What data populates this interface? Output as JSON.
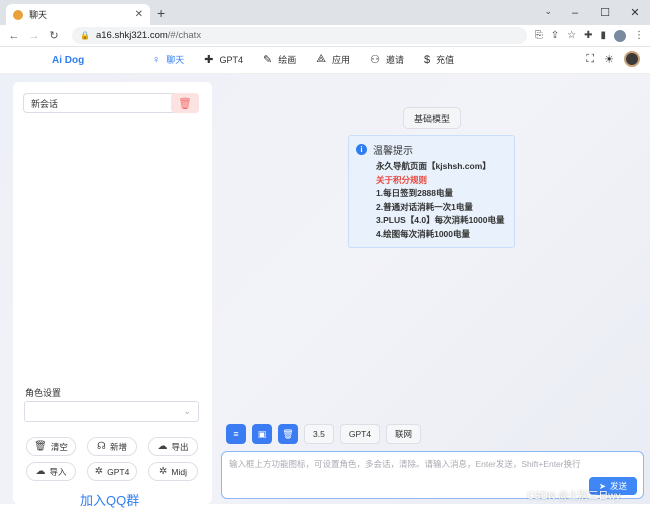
{
  "browser": {
    "tab_title": "聊天",
    "url_host": "a16.shkj321.com",
    "url_path": "/#/chatx",
    "icons": [
      "back-icon",
      "forward-icon",
      "reload-icon",
      "lock-icon",
      "install-icon",
      "share-icon",
      "star-icon",
      "extensions-icon",
      "sidepanel-icon",
      "profile-icon",
      "menu-icon"
    ]
  },
  "app": {
    "logo": "Ai Dog",
    "menu": [
      {
        "label": "聊天",
        "icon": "lightbulb-icon",
        "active": true
      },
      {
        "label": "GPT4",
        "icon": "plus-icon",
        "active": false
      },
      {
        "label": "绘画",
        "icon": "pen-icon",
        "active": false
      },
      {
        "label": "应用",
        "icon": "apps-icon",
        "active": false
      },
      {
        "label": "邀请",
        "icon": "invite-icon",
        "active": false
      },
      {
        "label": "充值",
        "icon": "dollar-icon",
        "active": false
      }
    ],
    "accent_color": "#2f7ef1"
  },
  "sidebar": {
    "conversation": "新会话",
    "role_label": "角色设置",
    "role_value": "",
    "buttons": [
      {
        "label": "清空",
        "icon": "trash-icon"
      },
      {
        "label": "新增",
        "icon": "headset-icon"
      },
      {
        "label": "导出",
        "icon": "cloud-download-icon"
      },
      {
        "label": "导入",
        "icon": "cloud-upload-icon"
      },
      {
        "label": "GPT4",
        "icon": "gear-icon"
      },
      {
        "label": "Midj",
        "icon": "gear-icon"
      }
    ],
    "qq_link": "加入QQ群"
  },
  "chat": {
    "model_button": "基础模型",
    "notice": {
      "title": "温馨提示",
      "lines": [
        "永久导航页面【kjshsh.com】",
        "关于积分规则",
        "1.每日签到2888电量",
        "2.普通对话消耗一次1电量",
        "3.PLUS【4.0】每次消耗1000电量",
        "4.绘图每次消耗1000电量"
      ]
    },
    "chips": [
      "3.5",
      "GPT4",
      "联网"
    ],
    "input_placeholder": "输入框上方功能图标，可设置角色，多会话，清除。请输入消息，Enter发送，Shift+Enter换行",
    "send_label": "发送"
  },
  "watermark": "CSDN @土别三日wy"
}
